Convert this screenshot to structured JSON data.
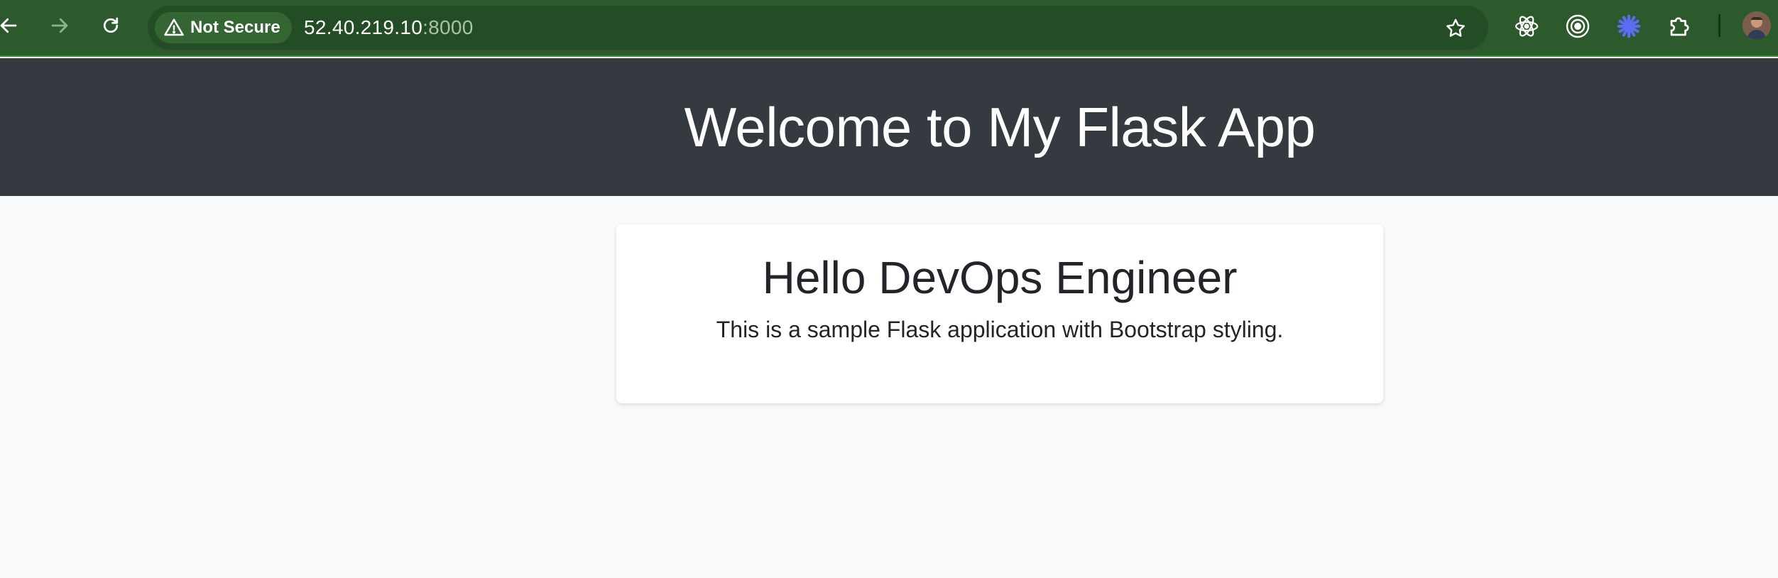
{
  "browser": {
    "security_label": "Not Secure",
    "url_host": "52.40.219.10",
    "url_port": ":8000",
    "icons": {
      "back": "arrow-left-icon",
      "forward": "arrow-right-icon",
      "reload": "reload-icon",
      "warning": "warning-triangle-icon",
      "bookmark": "star-icon",
      "extension_1": "react-icon",
      "extension_2": "target-icon",
      "extension_3": "asterisk-icon",
      "extensions_menu": "puzzle-icon",
      "profile": "avatar"
    },
    "colors": {
      "toolbar": "#2d5a2d",
      "omnibox": "#254d25"
    }
  },
  "page": {
    "header_title": "Welcome to My Flask App",
    "card_title": "Hello DevOps Engineer",
    "card_text": "This is a sample Flask application with Bootstrap styling.",
    "colors": {
      "header_bg": "#343a40",
      "body_bg": "#f8f9fa",
      "card_bg": "#ffffff"
    }
  }
}
